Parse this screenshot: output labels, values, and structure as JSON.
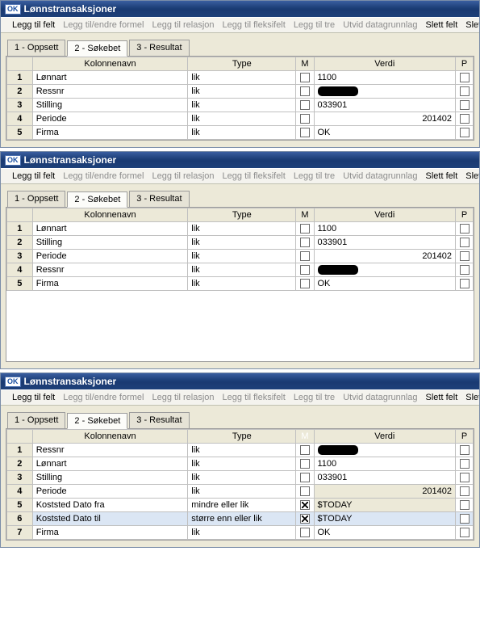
{
  "title": "Lønnstransaksjoner",
  "icon_label": "OK",
  "linkbar": {
    "legg_til_felt": "Legg til felt",
    "legg_til_endre_formel": "Legg til/endre formel",
    "legg_til_relasjon": "Legg til relasjon",
    "legg_til_fleksifelt": "Legg til fleksifelt",
    "legg_til_tre": "Legg til tre",
    "utvid_datagrunnlag": "Utvid datagrunnlag",
    "slett_felt": "Slett felt",
    "slett_al": "Slett al"
  },
  "tabs": {
    "oppsett": "1 - Oppsett",
    "sokebet": "2 - Søkebet",
    "resultat": "3 - Resultat"
  },
  "cols": {
    "kolonnenavn": "Kolonnenavn",
    "type": "Type",
    "m": "M",
    "verdi": "Verdi",
    "p": "P"
  },
  "panel1": {
    "rows": [
      {
        "n": "1",
        "kol": "Lønnart",
        "type": "lik",
        "m": false,
        "verdi": "1100",
        "align": "left",
        "p": false
      },
      {
        "n": "2",
        "kol": "Ressnr",
        "type": "lik",
        "m": false,
        "verdi": "[REDACTED]",
        "align": "left",
        "p": false
      },
      {
        "n": "3",
        "kol": "Stilling",
        "type": "lik",
        "m": false,
        "verdi": "033901",
        "align": "left",
        "p": false
      },
      {
        "n": "4",
        "kol": "Periode",
        "type": "lik",
        "m": false,
        "verdi": "201402",
        "align": "right",
        "p": false
      },
      {
        "n": "5",
        "kol": "Firma",
        "type": "lik",
        "m": false,
        "verdi": "OK",
        "align": "left",
        "p": false
      }
    ]
  },
  "panel2": {
    "rows": [
      {
        "n": "1",
        "kol": "Lønnart",
        "type": "lik",
        "m": false,
        "verdi": "1100",
        "align": "left",
        "p": false
      },
      {
        "n": "2",
        "kol": "Stilling",
        "type": "lik",
        "m": false,
        "verdi": "033901",
        "align": "left",
        "p": false
      },
      {
        "n": "3",
        "kol": "Periode",
        "type": "lik",
        "m": false,
        "verdi": "201402",
        "align": "right",
        "p": false
      },
      {
        "n": "4",
        "kol": "Ressnr",
        "type": "lik",
        "m": false,
        "verdi": "[REDACTED]",
        "align": "left",
        "p": false
      },
      {
        "n": "5",
        "kol": "Firma",
        "type": "lik",
        "m": false,
        "verdi": "OK",
        "align": "left",
        "p": false
      }
    ]
  },
  "panel3": {
    "selected_row": "6",
    "selected_col": "m",
    "rows": [
      {
        "n": "1",
        "kol": "Ressnr",
        "type": "lik",
        "m": false,
        "verdi": "[REDACTED]",
        "align": "left",
        "p": false
      },
      {
        "n": "2",
        "kol": "Lønnart",
        "type": "lik",
        "m": false,
        "verdi": "1100",
        "align": "left",
        "p": false
      },
      {
        "n": "3",
        "kol": "Stilling",
        "type": "lik",
        "m": false,
        "verdi": "033901",
        "align": "left",
        "p": false
      },
      {
        "n": "4",
        "kol": "Periode",
        "type": "lik",
        "m": false,
        "verdi": "201402",
        "align": "right",
        "shaded": true,
        "p": false
      },
      {
        "n": "5",
        "kol": "Koststed Dato fra",
        "type": "mindre eller lik",
        "m": true,
        "verdi": "$TODAY",
        "align": "left",
        "shaded": true,
        "p": false
      },
      {
        "n": "6",
        "kol": "Koststed Dato til",
        "type": "større enn eller lik",
        "m": true,
        "verdi": "$TODAY",
        "align": "left",
        "shaded": true,
        "p": false
      },
      {
        "n": "7",
        "kol": "Firma",
        "type": "lik",
        "m": false,
        "verdi": "OK",
        "align": "left",
        "p": false
      }
    ]
  }
}
